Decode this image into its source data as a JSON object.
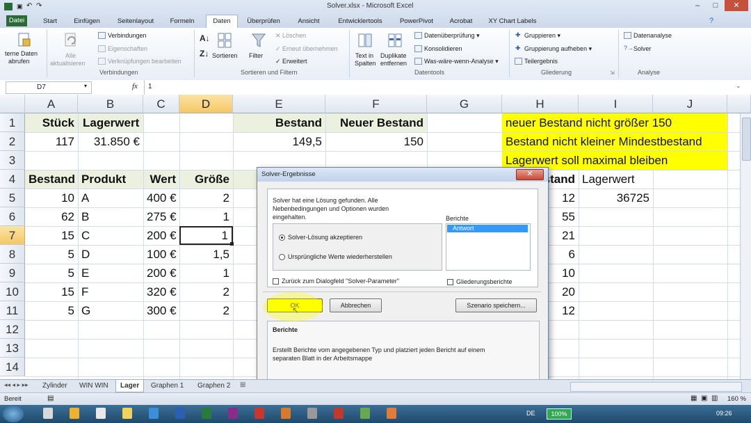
{
  "window": {
    "title": "Solver.xlsx - Microsoft Excel"
  },
  "tabs": {
    "file": "Datei",
    "items": [
      "Start",
      "Einfügen",
      "Seitenlayout",
      "Formeln",
      "Daten",
      "Überprüfen",
      "Ansicht",
      "Entwicklertools",
      "PowerPivot",
      "Acrobat",
      "XY Chart Labels"
    ],
    "active": "Daten"
  },
  "ribbon": {
    "ext_data": "terne Daten",
    "ext_data2": "abrufen",
    "refresh_all": "Alle",
    "refresh_all2": "aktualisieren",
    "connections": "Verbindungen",
    "properties": "Eigenschaften",
    "edit_links": "Verknüpfungen bearbeiten",
    "group_connections": "Verbindungen",
    "sort": "Sortieren",
    "filter": "Filter",
    "clear": "Löschen",
    "reapply": "Erneut übernehmen",
    "advanced": "Erweitert",
    "group_sort": "Sortieren und Filtern",
    "text_to_columns": "Text in",
    "text_to_columns2": "Spalten",
    "remove_dup": "Duplikate",
    "remove_dup2": "entfernen",
    "data_validation": "Datenüberprüfung",
    "consolidate": "Konsolidieren",
    "what_if": "Was-wäre-wenn-Analyse",
    "group_tools": "Datentools",
    "group": "Gruppieren",
    "ungroup": "Gruppierung aufheben",
    "subtotal": "Teilergebnis",
    "group_outline": "Gliederung",
    "data_analysis": "Datenanalyse",
    "solver": "Solver",
    "group_analysis": "Analyse"
  },
  "formula_bar": {
    "name_box": "D7",
    "fx": "fx",
    "value": "1"
  },
  "columns": [
    "A",
    "B",
    "C",
    "D",
    "E",
    "F",
    "G",
    "H",
    "I",
    "J"
  ],
  "rows": [
    "1",
    "2",
    "3",
    "4",
    "5",
    "6",
    "7",
    "8",
    "9",
    "10",
    "11",
    "12",
    "13",
    "14"
  ],
  "cells": {
    "A1": "Stück",
    "B1": "Lagerwert",
    "E1": "Bestand",
    "F1": "Neuer Bestand",
    "A2": "117",
    "B2": "31.850 €",
    "E2": "149,5",
    "F2": "150",
    "H1": "neuer Bestand nicht größer 150",
    "H2": "Bestand nicht kleiner Mindestbestand",
    "H3": "Lagerwert soll maximal bleiben",
    "A4": "Bestand",
    "B4": "Produkt",
    "C4": "Wert",
    "D4": "Größe",
    "H4": "stand",
    "I4": "Lagerwert",
    "I5": "36725"
  },
  "table": [
    {
      "bestand": "10",
      "produkt": "A",
      "wert": "400 €",
      "groesse": "2",
      "h": "12"
    },
    {
      "bestand": "62",
      "produkt": "B",
      "wert": "275 €",
      "groesse": "1",
      "h": "55"
    },
    {
      "bestand": "15",
      "produkt": "C",
      "wert": "200 €",
      "groesse": "1",
      "h": "21"
    },
    {
      "bestand": "5",
      "produkt": "D",
      "wert": "100 €",
      "groesse": "1,5",
      "h": "6"
    },
    {
      "bestand": "5",
      "produkt": "E",
      "wert": "200 €",
      "groesse": "1",
      "h": "10"
    },
    {
      "bestand": "15",
      "produkt": "F",
      "wert": "320 €",
      "groesse": "2",
      "h": "20"
    },
    {
      "bestand": "5",
      "produkt": "G",
      "wert": "300 €",
      "groesse": "2",
      "h": "12"
    }
  ],
  "dialog": {
    "title": "Solver-Ergebnisse",
    "message1": "Solver hat eine Lösung gefunden. Alle",
    "message2": "Nebenbedingungen und Optionen wurden",
    "message3": "eingehalten.",
    "reports_label": "Berichte",
    "report_item": "Antwort",
    "radio_keep": "Solver-Lösung akzeptieren",
    "radio_restore": "Ursprüngliche Werte wiederherstellen",
    "check_return": "Zurück zum Dialogfeld \"Solver-Parameter\"",
    "check_outline": "Gliederungsberichte",
    "ok": "OK",
    "cancel": "Abbrechen",
    "save_scenario": "Szenario speichern...",
    "desc_title": "Berichte",
    "desc1": "Erstellt Berichte vom angegebenen Typ und platziert jeden Bericht auf einem",
    "desc2": "separaten Blatt in der Arbeitsmappe"
  },
  "sheets": [
    "Zylinder",
    "WIN WIN",
    "Lager",
    "Graphen 1",
    "Graphen 2"
  ],
  "active_sheet": "Lager",
  "status": {
    "ready": "Bereit",
    "zoom": "160 %"
  },
  "taskbar": {
    "battery": "100%",
    "lang": "DE",
    "time": "09:26"
  },
  "colors": {
    "green_fill": "#ebf1de",
    "yellow_fill": "#ffff00",
    "highlight": "#ffff00",
    "file_tab": "#2a6a36"
  }
}
